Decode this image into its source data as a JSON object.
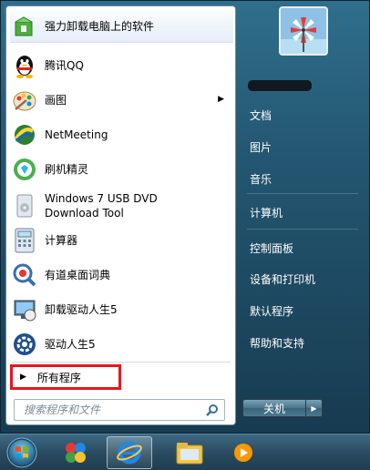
{
  "programs": [
    {
      "label": "强力卸载电脑上的软件",
      "icon": "uninstall-icon",
      "submenu": false
    },
    {
      "label": "腾讯QQ",
      "icon": "qq-penguin-icon",
      "submenu": false
    },
    {
      "label": "画图",
      "icon": "paint-icon",
      "submenu": true
    },
    {
      "label": "NetMeeting",
      "icon": "netmeeting-icon",
      "submenu": false
    },
    {
      "label": "刷机精灵",
      "icon": "flash-tool-icon",
      "submenu": false
    },
    {
      "label": "Windows 7 USB DVD Download Tool",
      "label_line1": "Windows 7 USB DVD",
      "label_line2": "Download Tool",
      "icon": "usb-dvd-tool-icon",
      "submenu": false
    },
    {
      "label": "计算器",
      "icon": "calculator-icon",
      "submenu": false
    },
    {
      "label": "有道桌面词典",
      "icon": "youdao-dict-icon",
      "submenu": false
    },
    {
      "label": "卸载驱动人生5",
      "icon": "uninstall-driver-icon",
      "submenu": false
    },
    {
      "label": "驱动人生5",
      "icon": "driver-life-icon",
      "submenu": false
    }
  ],
  "all_programs_label": "所有程序",
  "search": {
    "placeholder": "搜索程序和文件"
  },
  "right_items": [
    {
      "label": "文档"
    },
    {
      "label": "图片"
    },
    {
      "label": "音乐"
    },
    {
      "label": "计算机"
    },
    {
      "label": "控制面板"
    },
    {
      "label": "设备和打印机"
    },
    {
      "label": "默认程序"
    },
    {
      "label": "帮助和支持"
    }
  ],
  "shutdown_label": "关机",
  "colors": {
    "highlight_box": "#e8161c",
    "frame": "#245772"
  }
}
